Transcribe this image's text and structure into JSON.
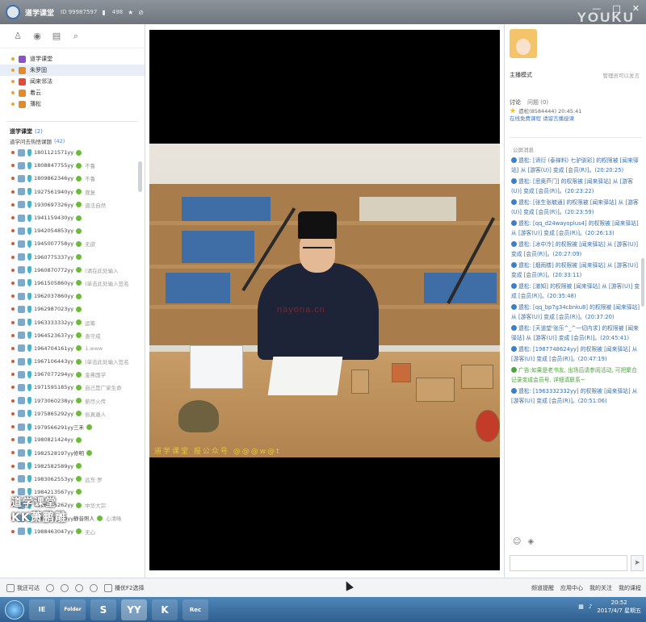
{
  "window": {
    "title": "道学课堂",
    "id_text": "ID 99987597",
    "viewer_count": "498",
    "youku_watermark": "YOUKU"
  },
  "channels": [
    {
      "label": "道学课堂",
      "color": "#8e4fc9"
    },
    {
      "label": "朱罗固",
      "color": "#e38b2a"
    },
    {
      "label": "闻来邻法",
      "color": "#e34a3a"
    },
    {
      "label": "着云",
      "color": "#e38b2a"
    },
    {
      "label": "薄松",
      "color": "#e38b2a"
    }
  ],
  "room": {
    "header": "道学课堂",
    "header_count": "(2)",
    "sub": "道学问去热悟课题",
    "sub_count": "(42)"
  },
  "users": [
    {
      "name": "1801121571yy",
      "note": ""
    },
    {
      "name": "1808847755yy",
      "note": "不鲁"
    },
    {
      "name": "1809862346yy",
      "note": "不鲁"
    },
    {
      "name": "1927561940yy",
      "note": "观复"
    },
    {
      "name": "1930697326yy",
      "note": "道法自然"
    },
    {
      "name": "1941159430yy",
      "note": ""
    },
    {
      "name": "1942054853yy",
      "note": ""
    },
    {
      "name": "1945007758yy",
      "note": "无欲"
    },
    {
      "name": "1960775337yy",
      "note": ""
    },
    {
      "name": "1960870772yy",
      "note": "(请在此处输入"
    },
    {
      "name": "1961505860yy",
      "note": "(单击此处输入签名"
    },
    {
      "name": "1962037860yy",
      "note": ""
    },
    {
      "name": "1962987023yy",
      "note": ""
    },
    {
      "name": "1963333332yy",
      "note": "运筹"
    },
    {
      "name": "1964523637yy",
      "note": "善守成"
    },
    {
      "name": "1964704161yy",
      "note": "1.www"
    },
    {
      "name": "1967106443yy",
      "note": "(单击此处输入签名"
    },
    {
      "name": "1967077294yy",
      "note": "金弗国学"
    },
    {
      "name": "1971595185yy",
      "note": "自己是广家生命"
    },
    {
      "name": "1973060238yy",
      "note": "薪尽火传"
    },
    {
      "name": "1975865292yy",
      "note": "俗真遁人"
    },
    {
      "name": "1979566291yy三禾",
      "note": ""
    },
    {
      "name": "1980821424yy",
      "note": ""
    },
    {
      "name": "1982528197yy修明",
      "note": ""
    },
    {
      "name": "1982582589yy",
      "note": ""
    },
    {
      "name": "1983062553yy",
      "note": "远东·罗"
    },
    {
      "name": "1984213567yy",
      "note": ""
    },
    {
      "name": "1986065262yy",
      "note": "中华大宗"
    },
    {
      "name": "1986025310yy静音照人",
      "note": "心清晰"
    },
    {
      "name": "1988463047yy",
      "note": "无心"
    }
  ],
  "kk_overlay": {
    "line1": "道学课堂",
    "line2": "KK萧鹏雕"
  },
  "video": {
    "subtitle": "道学课堂 报公众号 @@@w@t",
    "watermark": "nayona.cn"
  },
  "right_panel": {
    "anchor_label": "主播模式",
    "anchor_sub": "管理员可以发言",
    "tab_chat": "讨论",
    "tab_question": "问题",
    "tab_question_count": "(0)",
    "notice_user": "遗松(8584444) 20:45:41",
    "notice_link": "在线免费课程 请留言播授课",
    "chat_title": "公屏消息",
    "messages": [
      {
        "text": "遗松: [谛衍 (泰禅料) 七驴驯彩] 的权限被 [闻来驿站] 从 [游客(U)] 变成 [会员(R)]。(20:20:25)",
        "style": "blue"
      },
      {
        "text": "遗松: [思奥芦门] 的权限被 [闻来驿站] 从 [游客(U)] 变成 [会员(R)]。(20:23:22)",
        "style": "blue"
      },
      {
        "text": "遗松: [张生张毓通] 的权限被 [闻来驿站] 从 [游客(U)] 变成 [会员(R)]。(20:23:59)",
        "style": "blue"
      },
      {
        "text": "遗松: [qq_d24wayoplus4] 的权限被 [闻来驿站] 从 [游客(U)] 变成 [会员(R)]。(20:26:13)",
        "style": "blue"
      },
      {
        "text": "遗松: [冰中冷] 的权限被 [闻来驿站] 从 [游客(U)] 变成 [会员(R)]。(20:27:09)",
        "style": "blue"
      },
      {
        "text": "遗松: [烟雨楼] 的权限被 [闻来驿站] 从 [游客(U)] 变成 [会员(R)]。(20:33:11)",
        "style": "blue"
      },
      {
        "text": "遗松: [澈知] 的权限被 [闻来驿站] 从 [游客(U)] 变成 [会员(R)]。(20:35:48)",
        "style": "blue"
      },
      {
        "text": "遗松: [qq_bp7g34cbnku8] 的权限被 [闻来驿站] 从 [游客(U)] 变成 [会员(R)]。(20:37:20)",
        "style": "blue"
      },
      {
        "text": "遗松: [天道望'张乐^_^一切内求] 的权限被 [闻来驿站] 从 [游客(U)] 变成 [会员(R)]。(20:45:41)",
        "style": "blue"
      },
      {
        "text": "遗松: [1987748624yy] 的权限被 [闻来驿站] 从 [游客(U)] 变成 [会员(R)]。(20:47:19)",
        "style": "blue"
      },
      {
        "text": "广告:如果是老书友, 出场后请参阅活动, 可把聚合记录变成会员号, 详细请联系~",
        "style": "green"
      },
      {
        "text": "遗松: [1963332332yy] 的权限被 [闻来驿站] 从 [游客(U)] 变成 [会员(R)]。(20:51:06)",
        "style": "blue"
      }
    ]
  },
  "bottom_bar": {
    "left_label": "我还可达",
    "record_label": "播优F2选择",
    "right_items": [
      "频道提醒",
      "应用中心",
      "我的关注",
      "我的课程"
    ]
  },
  "taskbar": {
    "apps": [
      "IE",
      "Folder",
      "S",
      "YY",
      "K",
      "Rec"
    ],
    "time": "20:52",
    "date": "2017/4/7 星期五"
  }
}
